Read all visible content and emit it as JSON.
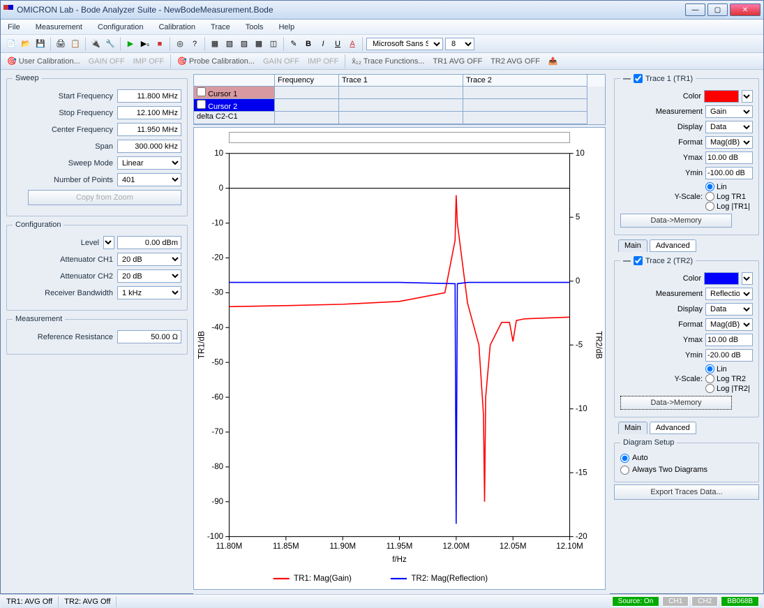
{
  "window": {
    "title": "OMICRON Lab - Bode Analyzer Suite - NewBodeMeasurement.Bode"
  },
  "menubar": [
    "File",
    "Measurement",
    "Configuration",
    "Calibration",
    "Trace",
    "Tools",
    "Help"
  ],
  "toolbar2": {
    "user_cal": "User Calibration...",
    "gain_off1": "GAIN OFF",
    "imp_off1": "IMP OFF",
    "probe_cal": "Probe Calibration...",
    "gain_off2": "GAIN OFF",
    "imp_off2": "IMP OFF",
    "trace_fn": "Trace Functions...",
    "tr1avg": "TR1 AVG OFF",
    "tr2avg": "TR2 AVG OFF"
  },
  "font_select": {
    "name": "Microsoft Sans Ser",
    "size": "8"
  },
  "sweep": {
    "legend": "Sweep",
    "start_label": "Start Frequency",
    "start": "11.800 MHz",
    "stop_label": "Stop Frequency",
    "stop": "12.100 MHz",
    "center_label": "Center Frequency",
    "center": "11.950 MHz",
    "span_label": "Span",
    "span": "300.000 kHz",
    "mode_label": "Sweep Mode",
    "mode": "Linear",
    "points_label": "Number of Points",
    "points": "401",
    "copy_btn": "Copy from Zoom"
  },
  "config": {
    "legend": "Configuration",
    "level_label": "Level",
    "level": "0.00 dBm",
    "att1_label": "Attenuator CH1",
    "att1": "20 dB",
    "att2_label": "Attenuator CH2",
    "att2": "20 dB",
    "rbw_label": "Receiver Bandwidth",
    "rbw": "1 kHz"
  },
  "meas": {
    "legend": "Measurement",
    "ref_label": "Reference Resistance",
    "ref": "50.00 Ω"
  },
  "cursor_table": {
    "headers": [
      "",
      "Frequency",
      "Trace 1",
      "Trace 2"
    ],
    "rows": [
      {
        "label": "Cursor 1",
        "bg": "c1bg"
      },
      {
        "label": "Cursor 2",
        "bg": "c2bg"
      },
      {
        "label": "delta C2-C1",
        "bg": ""
      }
    ]
  },
  "trace1": {
    "legend": "Trace 1 (TR1)",
    "color_label": "Color",
    "color": "#ff0000",
    "meas_label": "Measurement",
    "meas": "Gain",
    "disp_label": "Display",
    "disp": "Data",
    "fmt_label": "Format",
    "fmt": "Mag(dB)",
    "ymax_label": "Ymax",
    "ymax": "10.00 dB",
    "ymin_label": "Ymin",
    "ymin": "-100.00 dB",
    "yscale_label": "Y-Scale:",
    "r1": "Lin",
    "r2": "Log TR1",
    "r3": "Log |TR1|",
    "btn": "Data->Memory"
  },
  "trace2": {
    "legend": "Trace 2 (TR2)",
    "color_label": "Color",
    "color": "#0000ff",
    "meas_label": "Measurement",
    "meas": "Reflection",
    "disp_label": "Display",
    "disp": "Data",
    "fmt_label": "Format",
    "fmt": "Mag(dB)",
    "ymax_label": "Ymax",
    "ymax": "10.00 dB",
    "ymin_label": "Ymin",
    "ymin": "-20.00 dB",
    "yscale_label": "Y-Scale:",
    "r1": "Lin",
    "r2": "Log TR2",
    "r3": "Log |TR2|",
    "btn": "Data->Memory"
  },
  "diagram": {
    "legend": "Diagram Setup",
    "r1": "Auto",
    "r2": "Always Two Diagrams"
  },
  "tabs": {
    "main": "Main",
    "adv": "Advanced"
  },
  "export_btn": "Export Traces Data...",
  "status": {
    "l1": "TR1:  AVG Off",
    "l2": "TR2:  AVG Off",
    "src": "Source: On",
    "ch1": "CH1",
    "ch2": "CH2",
    "dev": "BB068B"
  },
  "chart_data": {
    "type": "line",
    "xlabel": "f/Hz",
    "y1label": "TR1/dB",
    "y2label": "TR2/dB",
    "xlim": [
      11.8,
      12.1
    ],
    "y1lim": [
      -100,
      10
    ],
    "y2lim": [
      -20,
      10
    ],
    "xticks": [
      11.8,
      11.85,
      11.9,
      11.95,
      12.0,
      12.05,
      12.1
    ],
    "xtick_labels": [
      "11.80M",
      "11.85M",
      "11.90M",
      "11.95M",
      "12.00M",
      "12.05M",
      "12.10M"
    ],
    "y1ticks": [
      -100,
      -90,
      -80,
      -70,
      -60,
      -50,
      -40,
      -30,
      -20,
      -10,
      0,
      10
    ],
    "y2ticks": [
      -20,
      -15,
      -10,
      -5,
      0,
      5,
      10
    ],
    "series": [
      {
        "name": "TR1: Mag(Gain)",
        "axis": "y1",
        "color": "#ff0000",
        "x": [
          11.8,
          11.85,
          11.9,
          11.95,
          11.99,
          11.999,
          12.0,
          12.001,
          12.01,
          12.02,
          12.024,
          12.025,
          12.026,
          12.03,
          12.04,
          12.047,
          12.05,
          12.053,
          12.06,
          12.1
        ],
        "y": [
          -34.0,
          -33.7,
          -33.3,
          -32.5,
          -30.0,
          -15.0,
          -2.0,
          -10.0,
          -33.0,
          -45.0,
          -65.0,
          -90.0,
          -60.0,
          -45.0,
          -38.5,
          -38.5,
          -44.0,
          -38.0,
          -37.5,
          -37.0
        ]
      },
      {
        "name": "TR2: Mag(Reflection)",
        "axis": "y2",
        "color": "#0000ff",
        "x": [
          11.8,
          11.95,
          11.999,
          12.0,
          12.001,
          12.01,
          12.1
        ],
        "y": [
          -0.1,
          -0.1,
          -0.2,
          -19.0,
          -0.2,
          -0.1,
          -0.1
        ]
      }
    ],
    "legend_items": [
      "TR1: Mag(Gain)",
      "TR2: Mag(Reflection)"
    ]
  }
}
